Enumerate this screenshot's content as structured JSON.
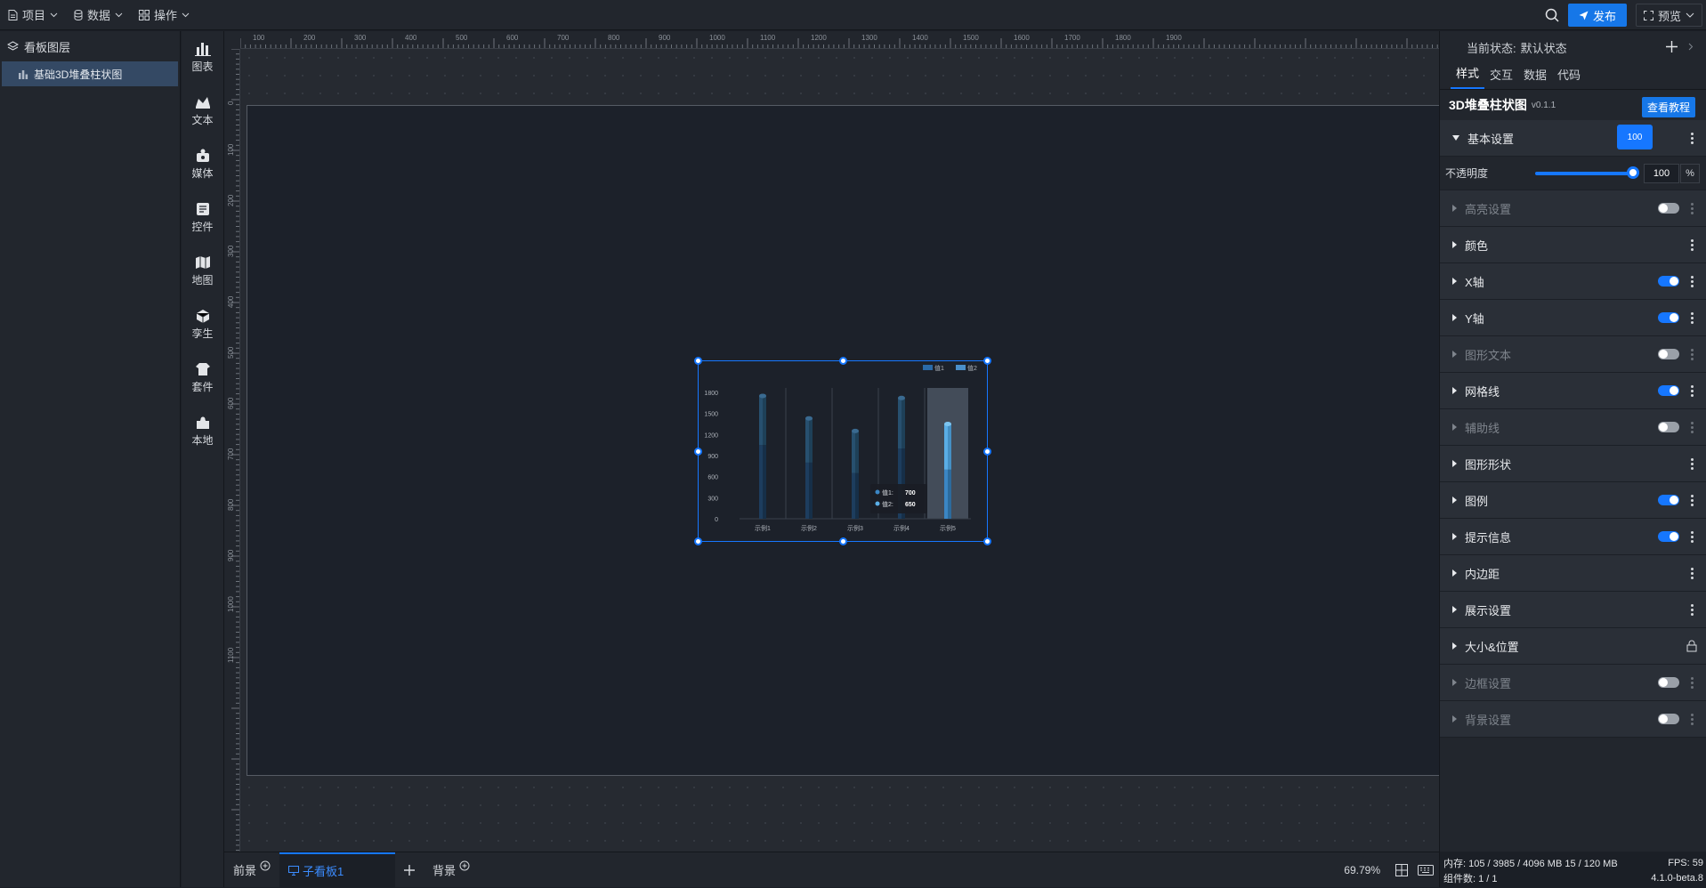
{
  "topbar": {
    "menus": [
      {
        "label": "项目",
        "icon": "file-icon"
      },
      {
        "label": "数据",
        "icon": "database-icon"
      },
      {
        "label": "操作",
        "icon": "grid-icon"
      }
    ],
    "publish_label": "发布",
    "preview_label": "预览"
  },
  "layers": {
    "title": "看板图层",
    "items": [
      {
        "label": "基础3D堆叠柱状图"
      }
    ]
  },
  "toolbox": {
    "items": [
      {
        "label": "图表",
        "icon": "chart-icon"
      },
      {
        "label": "文本",
        "icon": "text-icon"
      },
      {
        "label": "媒体",
        "icon": "media-icon"
      },
      {
        "label": "控件",
        "icon": "control-icon"
      },
      {
        "label": "地图",
        "icon": "map-icon"
      },
      {
        "label": "孪生",
        "icon": "twin-icon"
      },
      {
        "label": "套件",
        "icon": "kit-icon"
      },
      {
        "label": "本地",
        "icon": "local-icon"
      }
    ]
  },
  "ruler": {
    "top_ticks": [
      "100",
      "200",
      "300",
      "400",
      "500",
      "600",
      "700",
      "800",
      "900",
      "1000",
      "1100",
      "1200",
      "1300",
      "1400",
      "1500",
      "1600",
      "1700",
      "1800",
      "1900"
    ],
    "left_ticks": [
      "0",
      "100",
      "200",
      "300",
      "400",
      "500",
      "600",
      "700",
      "800",
      "900",
      "1000",
      "1100"
    ]
  },
  "chart_data": {
    "type": "bar",
    "stacked": true,
    "style": "3D",
    "categories": [
      "示例1",
      "示例2",
      "示例3",
      "示例4",
      "示例5"
    ],
    "series": [
      {
        "name": "值1",
        "values": [
          1050,
          800,
          650,
          1000,
          700
        ],
        "color": "#2a5b8a"
      },
      {
        "name": "值2",
        "values": [
          700,
          630,
          600,
          720,
          650
        ],
        "color": "#3f7fb5"
      }
    ],
    "ylim": [
      0,
      1800
    ],
    "yticks": [
      "0",
      "300",
      "600",
      "900",
      "1200",
      "1500",
      "1800"
    ],
    "legend_position": "top-right",
    "highlighted_category_index": 4,
    "tooltip": {
      "rows": [
        {
          "label": "值1:",
          "value": "700"
        },
        {
          "label": "值2:",
          "value": "650"
        }
      ]
    }
  },
  "bottom": {
    "front_label": "前景",
    "active_tab_label": "子看板1",
    "back_label": "背景",
    "zoom": "69.79%"
  },
  "right_panel": {
    "state_label": "当前状态:",
    "state_value": "默认状态",
    "tabs": [
      "样式",
      "交互",
      "数据",
      "代码"
    ],
    "component_name": "3D堆叠柱状图",
    "component_version": "v0.1.1",
    "tutorial_label": "查看教程",
    "basic_section": "基本设置",
    "opacity_label": "不透明度",
    "opacity_value": "100",
    "opacity_tip": "100",
    "opacity_unit": "%",
    "sections": [
      {
        "label": "高亮设置",
        "toggle": "off",
        "disabled": true
      },
      {
        "label": "颜色",
        "toggle": "none",
        "disabled": false
      },
      {
        "label": "X轴",
        "toggle": "on",
        "disabled": false
      },
      {
        "label": "Y轴",
        "toggle": "on",
        "disabled": false
      },
      {
        "label": "图形文本",
        "toggle": "off",
        "disabled": true
      },
      {
        "label": "网格线",
        "toggle": "on",
        "disabled": false
      },
      {
        "label": "辅助线",
        "toggle": "off",
        "disabled": true
      },
      {
        "label": "图形形状",
        "toggle": "none",
        "disabled": false
      },
      {
        "label": "图例",
        "toggle": "on",
        "disabled": false
      },
      {
        "label": "提示信息",
        "toggle": "on",
        "disabled": false
      },
      {
        "label": "内边距",
        "toggle": "none",
        "disabled": false
      },
      {
        "label": "展示设置",
        "toggle": "none",
        "disabled": false
      },
      {
        "label": "大小&位置",
        "toggle": "lock",
        "disabled": false
      },
      {
        "label": "边框设置",
        "toggle": "off",
        "disabled": true
      },
      {
        "label": "背景设置",
        "toggle": "off",
        "disabled": true
      }
    ],
    "footer": {
      "memory": "内存: 105 / 3985 / 4096 MB 15 / 120 MB",
      "fps": "FPS: 59",
      "components": "组件数: 1 / 1",
      "version": "4.1.0-beta.8"
    }
  },
  "colors": {
    "accent": "#1677ff",
    "panel": "#22262d",
    "board": "#1c212a"
  }
}
